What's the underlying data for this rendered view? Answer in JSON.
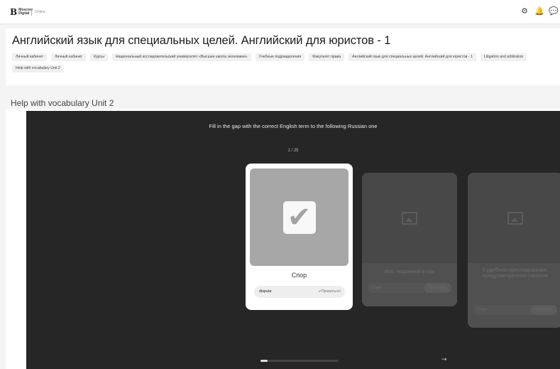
{
  "brand": {
    "mark": "B",
    "name": "Moscow Digital",
    "sub": "Online"
  },
  "top_icons": [
    "gear-icon",
    "bell-icon",
    "chat-icon"
  ],
  "top_icon_glyphs": [
    "⚙",
    "🔔",
    "💬"
  ],
  "page_title": "Английский язык для специальных целей. Английский для юристов - 1",
  "breadcrumbs": [
    "Личный кабинет",
    "Личный кабинет",
    "Курсы",
    "Национальный исследовательский университет «Высшая школа экономики»",
    "Учебные подразделения",
    "Факультет права",
    "Английский язык для специальных целей. Английский для юристов - 1",
    "Litigation and arbitration",
    "Help with vocabulary Unit 2"
  ],
  "section_title": "Help with vocabulary Unit 2",
  "player": {
    "instruction": "Fill in the gap with the correct English term to the following Russian one",
    "progress": "1 / 25",
    "active_card": {
      "term": "Спор",
      "answer": "dispute",
      "status": "Правильно!"
    },
    "next_cards": [
      {
        "text": "Иск, поданный в суд",
        "input_placeholder": "Ответ",
        "button": "Проверить"
      },
      {
        "text": "Судебное преследование, предусмотренное законом",
        "input_placeholder": "Ответ",
        "button": "Проверить"
      }
    ],
    "slider_progress": 0.09,
    "next_arrow": "→"
  }
}
